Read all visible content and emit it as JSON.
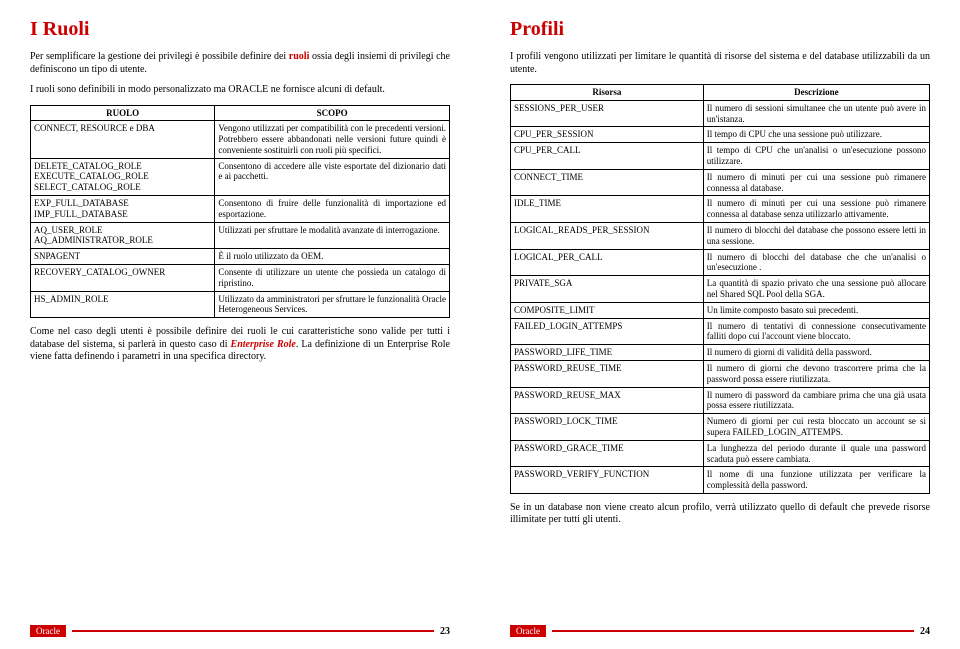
{
  "left": {
    "title": "I Ruoli",
    "p1_a": "Per semplificare la gestione dei privilegi è possibile definire dei ",
    "p1_b": "ruoli",
    "p1_c": " ossia degli insiemi di privilegi che definiscono un tipo di utente.",
    "p2": "I ruoli sono definibili in modo personalizzato ma ORACLE ne fornisce alcuni di default.",
    "th1": "RUOLO",
    "th2": "SCOPO",
    "rows": [
      {
        "c1": "CONNECT, RESOURCE e DBA",
        "c2": "Vengono utilizzati per compatibilità con le precedenti versioni. Potrebbero essere abbandonati nelle versioni future quindi è conveniente sostituirli con ruoli più specifici."
      },
      {
        "c1": "DELETE_CATALOG_ROLE EXECUTE_CATALOG_ROLE SELECT_CATALOG_ROLE",
        "c2": "Consentono di accedere alle viste esportate del dizionario dati e ai pacchetti."
      },
      {
        "c1": "EXP_FULL_DATABASE IMP_FULL_DATABASE",
        "c2": "Consentono di fruire delle funzionalità di importazione ed esportazione."
      },
      {
        "c1": "AQ_USER_ROLE AQ_ADMINISTRATOR_ROLE",
        "c2": "Utilizzati per sfruttare le modalità avanzate di interrogazione."
      },
      {
        "c1": "SNPAGENT",
        "c2": "È il ruolo utilizzato da OEM."
      },
      {
        "c1": "RECOVERY_CATALOG_OWNER",
        "c2": "Consente di utilizzare un utente che possieda un catalogo di ripristino."
      },
      {
        "c1": "HS_ADMIN_ROLE",
        "c2": "Utilizzato da amministratori per sfruttare le funzionalità Oracle Heterogeneous Services."
      }
    ],
    "p3_a": "Come nel caso degli utenti è possibile definire dei ruoli le cui caratteristiche sono valide per tutti i database del sistema, si parlerà in questo caso di ",
    "p3_b": "Enterprise Role",
    "p3_c": ". La definizione di un Enterprise Role viene fatta definendo i parametri in una specifica directory.",
    "footer_label": "Oracle",
    "footer_num": "23"
  },
  "right": {
    "title": "Profili",
    "p1": "I profili vengono utilizzati per limitare le quantità di risorse del sistema e del database utilizzabili da un utente.",
    "th1": "Risorsa",
    "th2": "Descrizione",
    "rows": [
      {
        "c1": "SESSIONS_PER_USER",
        "c2": "Il numero di sessioni simultanee che un utente può avere in un'istanza."
      },
      {
        "c1": "CPU_PER_SESSION",
        "c2": "Il tempo di CPU che una sessione può utilizzare."
      },
      {
        "c1": "CPU_PER_CALL",
        "c2": "Il tempo di CPU che un'analisi o un'esecuzione possono utilizzare."
      },
      {
        "c1": "CONNECT_TIME",
        "c2": "Il numero di minuti per cui una sessione può rimanere connessa al database."
      },
      {
        "c1": "IDLE_TIME",
        "c2": "Il numero di minuti per cui una sessione può rimanere connessa al database senza utilizzarlo attivamente."
      },
      {
        "c1": "LOGICAL_READS_PER_SESSION",
        "c2": "Il numero di blocchi del database che possono essere letti in una sessione."
      },
      {
        "c1": "LOGICAL_PER_CALL",
        "c2": "Il numero di blocchi del database che che un'analisi o un'esecuzione ."
      },
      {
        "c1": "PRIVATE_SGA",
        "c2": "La quantità di spazio privato che una sessione può allocare nel Shared SQL Pool della SGA."
      },
      {
        "c1": "COMPOSITE_LIMIT",
        "c2": "Un limite composto basato sui precedenti."
      },
      {
        "c1": "FAILED_LOGIN_ATTEMPS",
        "c2": "Il numero di tentativi di connessione consecutivamente falliti dopo cui l'account viene bloccato."
      },
      {
        "c1": "PASSWORD_LIFE_TIME",
        "c2": "Il numero di giorni di validità della password."
      },
      {
        "c1": "PASSWORD_REUSE_TIME",
        "c2": "Il numero di giorni che devono trascorrere prima che la password possa essere riutilizzata."
      },
      {
        "c1": "PASSWORD_REUSE_MAX",
        "c2": "Il numero di password da cambiare prima che una già usata possa essere riutilizzata."
      },
      {
        "c1": "PASSWORD_LOCK_TIME",
        "c2": "Numero di giorni per cui resta bloccato un account se si supera FAILED_LOGIN_ATTEMPS."
      },
      {
        "c1": "PASSWORD_GRACE_TIME",
        "c2": "La lunghezza del periodo durante il quale una password scaduta può essere cambiata."
      },
      {
        "c1": "PASSWORD_VERIFY_FUNCTION",
        "c2": "Il nome di una funzione utilizzata per verificare la complessità della password."
      }
    ],
    "p2": "Se in un database non viene creato alcun profilo, verrà utilizzato quello di default che prevede risorse illimitate per tutti gli utenti.",
    "footer_label": "Oracle",
    "footer_num": "24"
  }
}
